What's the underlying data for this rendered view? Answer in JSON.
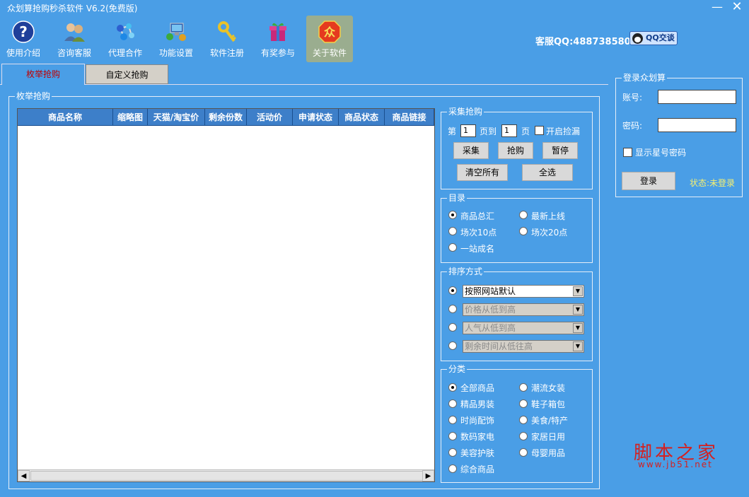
{
  "window": {
    "title": "众划算抢购秒杀软件 V6.2(免费版)",
    "minimize_glyph": "—",
    "close_glyph": "✕"
  },
  "toolbar": [
    {
      "label": "使用介绍",
      "icon": "help-icon"
    },
    {
      "label": "咨询客服",
      "icon": "customer-service-icon"
    },
    {
      "label": "代理合作",
      "icon": "molecule-icon"
    },
    {
      "label": "功能设置",
      "icon": "network-settings-icon"
    },
    {
      "label": "软件注册",
      "icon": "key-icon"
    },
    {
      "label": "有奖参与",
      "icon": "gift-box-icon"
    },
    {
      "label": "关于软件",
      "icon": "zhong-logo-icon",
      "active": true,
      "glyph": "众"
    }
  ],
  "contact": {
    "text": "客服QQ:488738580",
    "qq_button": "QQ交谈"
  },
  "tabs": [
    {
      "label": "枚举抢购",
      "active": true
    },
    {
      "label": "自定义抢购",
      "active": false
    }
  ],
  "main_group": {
    "title": "枚举抢购",
    "columns": [
      "商品名称",
      "缩略图",
      "天猫/淘宝价",
      "剩余份数",
      "活动价",
      "申请状态",
      "商品状态",
      "商品链接"
    ],
    "scroll_left": "◀",
    "scroll_right": "▶"
  },
  "collect": {
    "title": "采集抢购",
    "page_prefix": "第",
    "from_page": "1",
    "page_to": "页到",
    "to_page": "1",
    "page_suffix": "页",
    "auto_pick_label": "开启捡漏",
    "buttons": {
      "collect": "采集",
      "buy": "抢购",
      "pause": "暂停",
      "clear_all": "清空所有",
      "select_all": "全选"
    }
  },
  "catalog": {
    "title": "目录",
    "options": [
      "商品总汇",
      "最新上线",
      "场次10点",
      "场次20点",
      "一站成名"
    ],
    "selected": "商品总汇"
  },
  "sort": {
    "title": "排序方式",
    "options": [
      "按照网站默认",
      "价格从低到高",
      "人气从低到高",
      "剩余时间从低往高"
    ],
    "selected": "按照网站默认"
  },
  "category": {
    "title": "分类",
    "options": [
      "全部商品",
      "潮流女装",
      "精品男装",
      "鞋子箱包",
      "时尚配饰",
      "美食/特产",
      "数码家电",
      "家居日用",
      "美容护肤",
      "母婴用品",
      "综合商品"
    ],
    "selected": "全部商品"
  },
  "login": {
    "title": "登录众划算",
    "account_label": "账号:",
    "account_value": "",
    "password_label": "密码:",
    "password_value": "",
    "show_password_label": "显示星号密码",
    "login_button": "登录",
    "status": "状态:未登录"
  },
  "watermark": {
    "text": "脚本之家",
    "url": "www.jb51.net"
  },
  "colors": {
    "background": "#4a9ee6",
    "header": "#3d7fc9",
    "status": "#f7f070",
    "watermark": "#d42020"
  }
}
